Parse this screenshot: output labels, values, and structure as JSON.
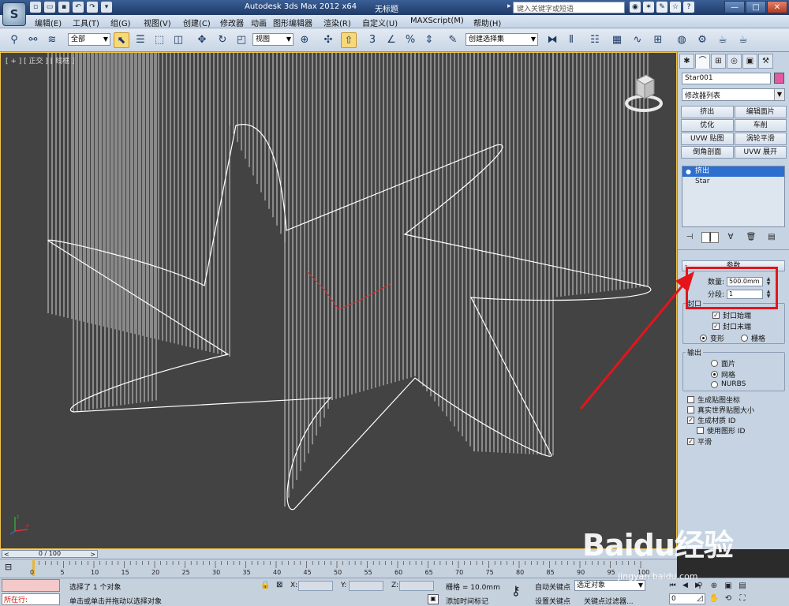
{
  "titlebar": {
    "app_logo": "S",
    "title": "Autodesk 3ds Max  2012 x64",
    "document": "无标题",
    "search_placeholder": "键入关键字或短语",
    "window_buttons": [
      "—",
      "□",
      "✕"
    ]
  },
  "menu": [
    "编辑(E)",
    "工具(T)",
    "组(G)",
    "视图(V)",
    "创建(C)",
    "修改器",
    "动画",
    "图形编辑器",
    "渲染(R)",
    "自定义(U)",
    "MAXScript(M)",
    "帮助(H)"
  ],
  "toolbar": {
    "selection_filter": "全部",
    "ref_coord": "视图",
    "named_selection": "创建选择集",
    "snap_label": "3"
  },
  "viewport": {
    "label": "[ + ] [ 正交 ] [ 线框 ]"
  },
  "command_panel": {
    "object_name": "Star001",
    "object_color": "#e25aa0",
    "modifier_list": "修改器列表",
    "modifier_buttons": [
      "挤出",
      "编辑面片",
      "优化",
      "车削",
      "UVW 贴图",
      "涡轮平滑",
      "倒角剖面",
      "UVW 展开"
    ],
    "stack": [
      "挤出",
      "Star"
    ],
    "rollout_title": "参数",
    "amount_label": "数量:",
    "amount_value": "500.0mm",
    "segments_label": "分段:",
    "segments_value": "1",
    "capping_label": "封口",
    "cap_start": "封口始端",
    "cap_end": "封口末端",
    "morph": "变形",
    "grid": "栅格",
    "output_label": "输出",
    "output_patch": "面片",
    "output_mesh": "网格",
    "output_nurbs": "NURBS",
    "gen_mapping": "生成贴图坐标",
    "real_world": "真实世界贴图大小",
    "gen_matid": "生成材质 ID",
    "use_shape_ids": "使用图形 ID",
    "smooth": "平滑"
  },
  "timeline": {
    "frame_display": "0 / 100",
    "left_arrow": "<",
    "right_arrow": ">",
    "tick_labels": [
      "0",
      "5",
      "10",
      "15",
      "20",
      "25",
      "30",
      "35",
      "40",
      "45",
      "50",
      "55",
      "60",
      "65",
      "70",
      "75",
      "80",
      "85",
      "90",
      "95",
      "100"
    ]
  },
  "status": {
    "maxscript_prompt": "所在行:",
    "selected_text": "选择了 1 个对象",
    "prompt_text": "单击或单击并拖动以选择对象",
    "x_label": "X:",
    "y_label": "Y:",
    "z_label": "Z:",
    "grid_text": "栅格 = 10.0mm",
    "auto_key": "自动关键点",
    "selected_mode": "选定对象",
    "set_key": "设置关键点",
    "key_filters": "关键点过滤器...",
    "add_time_tag": "添加时间标记",
    "frame_value": "0"
  },
  "watermark": {
    "main": "Baidu经验",
    "sub": "jingyan.baidu.com"
  }
}
